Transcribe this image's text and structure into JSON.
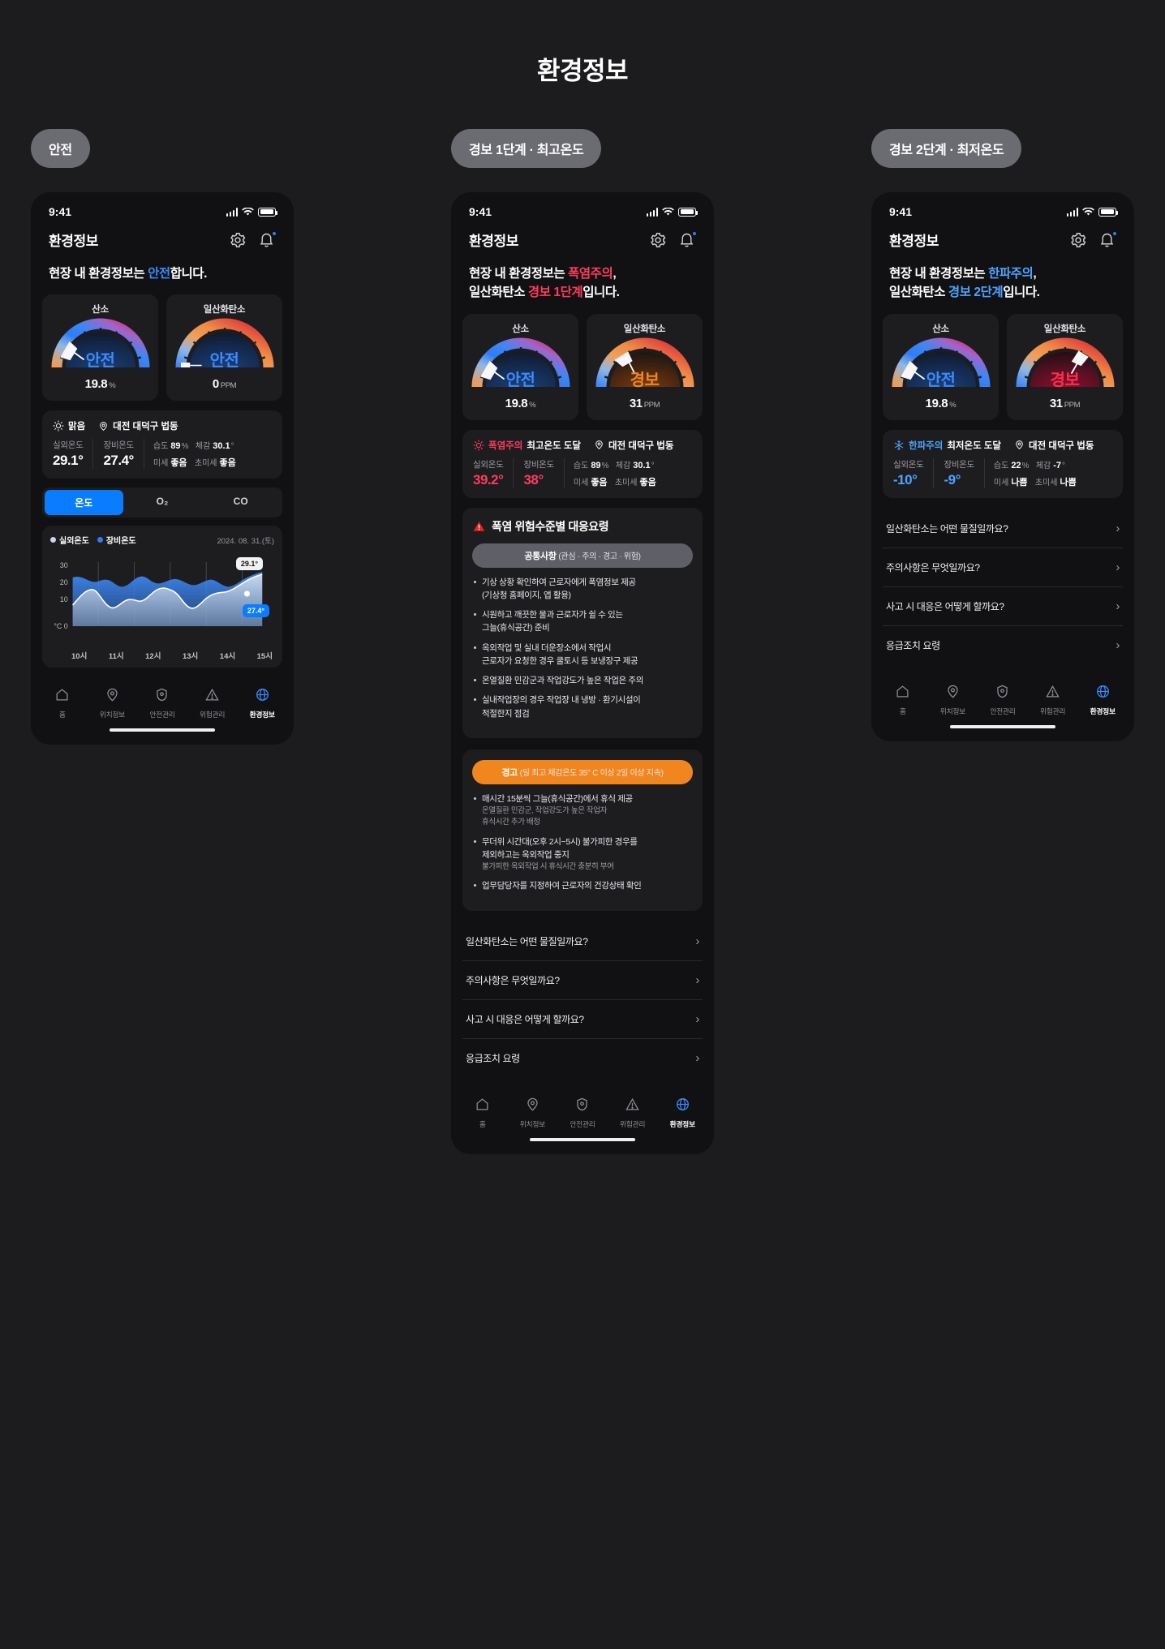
{
  "page_title": "환경정보",
  "icons": {
    "gear": "gear-icon",
    "bell": "bell-icon",
    "sun": "sun-icon",
    "snow": "snowflake-icon",
    "pin": "location-pin-icon",
    "warning": "warning-triangle-icon",
    "chevron": "chevron-right-icon"
  },
  "colors": {
    "accent_blue": "#0a7cff",
    "text_blue": "#3b8bfd",
    "alert_red": "#ff3b5c",
    "cold_blue": "#4fa3ff",
    "orange": "#f2861e",
    "card_bg": "#1d1d20",
    "phone_bg": "#111113",
    "page_bg": "#1c1c1e"
  },
  "nav": {
    "items": [
      {
        "label": "홈",
        "icon": "home-icon"
      },
      {
        "label": "위치정보",
        "icon": "location-icon"
      },
      {
        "label": "안전관리",
        "icon": "shield-icon"
      },
      {
        "label": "위험관리",
        "icon": "alert-icon"
      },
      {
        "label": "환경정보",
        "icon": "globe-icon"
      }
    ],
    "active_index": 4
  },
  "status_bar": {
    "time": "9:41"
  },
  "app_header": {
    "title": "환경정보"
  },
  "faq": {
    "items": [
      "일산화탄소는 어떤 물질일까요?",
      "주의사항은 무엇일까요?",
      "사고 시 대응은 어떻게 할까요?",
      "응급조치 요령"
    ]
  },
  "phones": [
    {
      "pill": "안전",
      "headline": {
        "pre": "현장 내 환경정보는 ",
        "accent": "안전",
        "post": "합니다."
      },
      "gauges": [
        {
          "title": "산소",
          "state": "안전",
          "state_color": "#3b8bfd",
          "value": "19.8",
          "unit": "%",
          "needle_pct": 22
        },
        {
          "title": "일산화탄소",
          "state": "안전",
          "state_color": "#3b8bfd",
          "value": "0",
          "unit": "PPM",
          "needle_pct": 3
        }
      ],
      "weather": {
        "condition": "맑음",
        "condition_icon": "sun-icon",
        "location": "대전 대덕구 법동",
        "outdoor_label": "실외온도",
        "outdoor_value": "29.1°",
        "device_label": "장비온도",
        "device_value": "27.4°",
        "humidity_label": "습도",
        "humidity_value": "89",
        "humidity_unit": "%",
        "feels_label": "체감",
        "feels_value": "30.1",
        "feels_unit": "°",
        "dust_label": "미세",
        "dust_value": "좋음",
        "ultra_label": "초미세",
        "ultra_value": "좋음",
        "state": "normal"
      },
      "segments": {
        "items": [
          "온도",
          "O₂",
          "CO"
        ],
        "active_index": 0
      },
      "chart_card": {
        "legend": [
          {
            "label": "실외온도",
            "color": "#c8d6ea"
          },
          {
            "label": "장비온도",
            "color": "#2f7cf6"
          }
        ],
        "date": "2024. 08. 31.(토)",
        "tooltip_outdoor": "29.1°",
        "tooltip_device": "27.4°"
      }
    },
    {
      "pill": "경보 1단계 · 최고온도",
      "headline": {
        "pre": "현장 내 환경정보는 ",
        "accent": "폭염주의",
        "post": ",",
        "line2_pre": "일산화탄소 ",
        "line2_accent": "경보 1단계",
        "line2_post": "입니다."
      },
      "gauges": [
        {
          "title": "산소",
          "state": "안전",
          "state_color": "#3b8bfd",
          "value": "19.8",
          "unit": "%",
          "needle_pct": 22
        },
        {
          "title": "일산화탄소",
          "state": "경보",
          "state_color": "#f2861e",
          "value": "31",
          "unit": "PPM",
          "needle_pct": 28
        }
      ],
      "weather": {
        "condition": "폭염주의",
        "condition_icon": "sun-icon",
        "condition_note": "최고온도 도달",
        "location": "대전 대덕구 법동",
        "outdoor_label": "실외온도",
        "outdoor_value": "39.2°",
        "device_label": "장비온도",
        "device_value": "38°",
        "humidity_label": "습도",
        "humidity_value": "89",
        "humidity_unit": "%",
        "feels_label": "체감",
        "feels_value": "30.1",
        "feels_unit": "°",
        "dust_label": "미세",
        "dust_value": "좋음",
        "ultra_label": "초미세",
        "ultra_value": "좋음",
        "state": "hot"
      },
      "warning": {
        "title": "폭염 위험수준별 대응요령",
        "sections": [
          {
            "header_main": "공통사항",
            "header_sub": "(관심 · 주의 · 경고 · 위험)",
            "style": "grey",
            "items": [
              {
                "text": "기상 상황 확인하여 근로자에게 폭염정보 제공\n(기상청 홈페이지, 앱 활용)"
              },
              {
                "text": "시원하고 깨끗한 물과 근로자가 쉴 수 있는\n그늘(휴식공간) 준비"
              },
              {
                "text": "옥외작업 및 실내 더운장소에서 작업시\n근로자가 요청한 경우 쿨토시 등 보냉장구 제공"
              },
              {
                "text": "온열질환 민감군과 작업강도가 높은 작업은 주의"
              },
              {
                "text": "실내작업장의 경우 작업장 내 냉방 · 환기시설이\n적절한지 점검"
              }
            ]
          },
          {
            "header_main": "경고",
            "header_sub": "(일 최고 체감온도 35° C 이상 2일 이상 지속)",
            "style": "orange",
            "items": [
              {
                "text": "매시간 15분씩 그늘(휴식공간)에서 휴식 제공",
                "sub": "온열질환 민감군, 작업강도가 높은 작업자\n휴식시간 추가 배정"
              },
              {
                "text": "무더위 시간대(오후 2시~5시) 불가피한 경우를\n제외하고는 옥외작업 중지",
                "sub": "불가피한 옥외작업 시 휴식시간 충분히 부여"
              },
              {
                "text": "업무담당자를 지정하여 근로자의 건강상태 확인"
              }
            ]
          }
        ]
      }
    },
    {
      "pill": "경보 2단계 · 최저온도",
      "headline": {
        "pre": "현장 내 환경정보는 ",
        "accent": "한파주의",
        "post": ",",
        "line2_pre": "일산화탄소 ",
        "line2_accent": "경보 2단계",
        "line2_post": "입니다."
      },
      "gauges": [
        {
          "title": "산소",
          "state": "안전",
          "state_color": "#3b8bfd",
          "value": "19.8",
          "unit": "%",
          "needle_pct": 22
        },
        {
          "title": "일산화탄소",
          "state": "경보",
          "state_color": "#ff2d4f",
          "value": "31",
          "unit": "PPM",
          "needle_pct": 55
        }
      ],
      "weather": {
        "condition": "한파주의",
        "condition_icon": "snowflake-icon",
        "condition_note": "최저온도 도달",
        "location": "대전 대덕구 법동",
        "outdoor_label": "실외온도",
        "outdoor_value": "-10°",
        "device_label": "장비온도",
        "device_value": "-9°",
        "humidity_label": "습도",
        "humidity_value": "22",
        "humidity_unit": "%",
        "feels_label": "체감",
        "feels_value": "-7",
        "feels_unit": "°",
        "dust_label": "미세",
        "dust_value": "나쁨",
        "ultra_label": "초미세",
        "ultra_value": "나쁨",
        "state": "cold"
      }
    }
  ],
  "chart_data": {
    "type": "area",
    "title": "온도",
    "xlabel": "",
    "ylabel": "°C",
    "ylim": [
      0,
      33
    ],
    "yticks": [
      0,
      10,
      20,
      30
    ],
    "x": [
      "10시",
      "11시",
      "12시",
      "13시",
      "14시",
      "15시"
    ],
    "series": [
      {
        "name": "실외온도",
        "color": "#c8d6ea",
        "values": [
          13.0,
          15.5,
          16.8,
          15.0,
          11.8,
          13.2,
          14.8,
          13.6,
          15.8,
          16.6,
          15.9,
          13.4,
          12.6,
          14.4,
          15.6,
          16.2,
          17.4,
          18.6
        ]
      },
      {
        "name": "장비온도",
        "color": "#2f7cf6",
        "values": [
          19.2,
          19.6,
          18.3,
          18.0,
          15.6,
          17.0,
          17.6,
          15.2,
          17.8,
          19.3,
          18.4,
          15.2,
          14.6,
          16.2,
          16.0,
          17.2,
          18.4,
          19.8
        ]
      }
    ],
    "annotations": [
      {
        "label": "29.1°",
        "series": "실외온도",
        "style": "white"
      },
      {
        "label": "27.4°",
        "series": "장비온도",
        "style": "blue"
      }
    ],
    "legend_position": "top-left",
    "grid": true
  }
}
